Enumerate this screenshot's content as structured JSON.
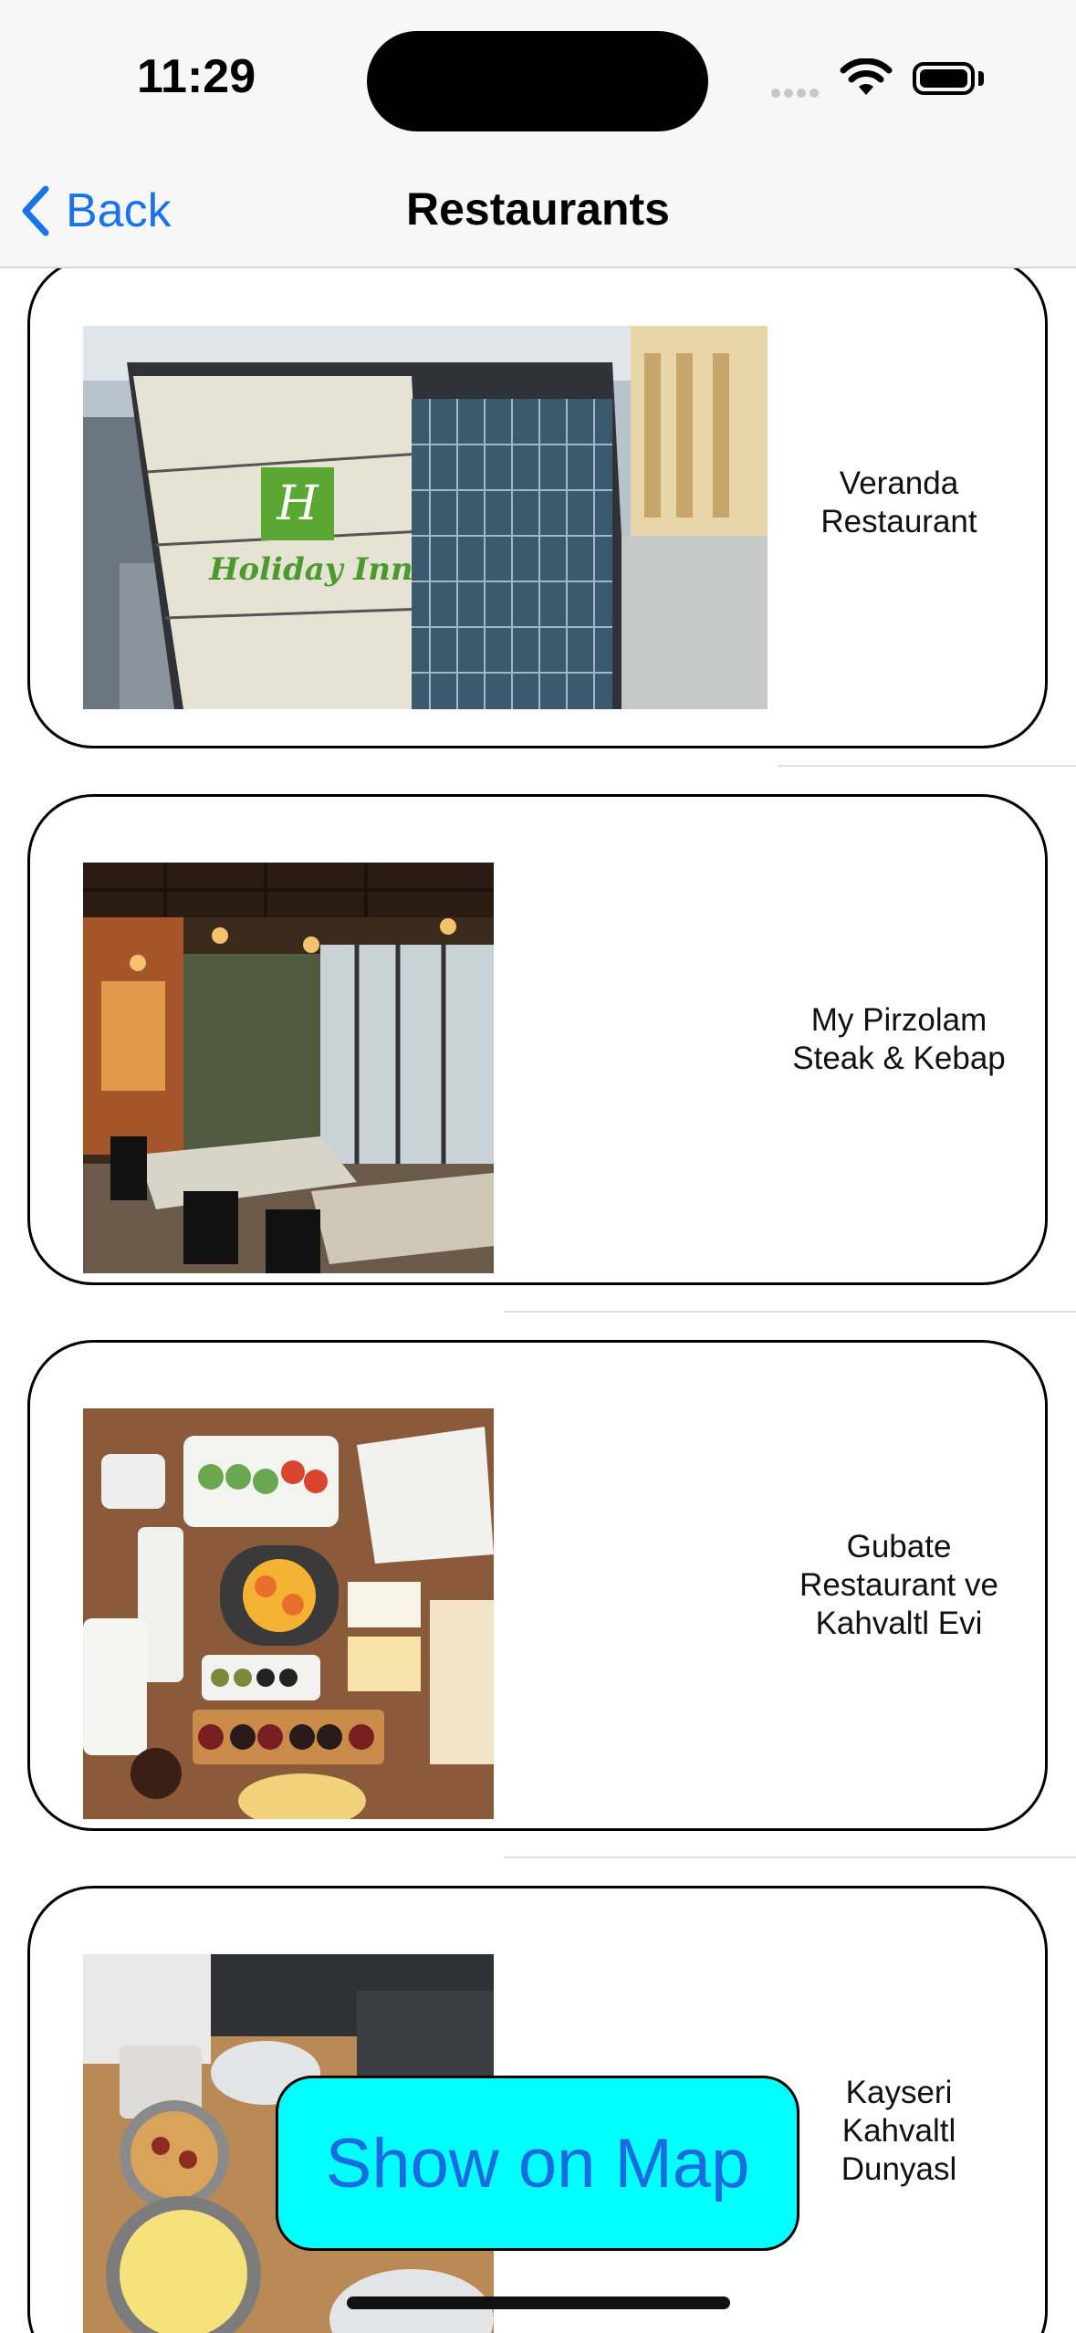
{
  "status_bar": {
    "time": "11:29"
  },
  "nav": {
    "back_label": "Back",
    "title": "Restaurants"
  },
  "restaurants": [
    {
      "name": "Veranda\nRestaurant",
      "image": "hotel-building-photo"
    },
    {
      "name": "My Pirzolam\nSteak & Kebap",
      "image": "restaurant-interior-photo"
    },
    {
      "name": "Gubate\nRestaurant ve\nKahvaltl Evi",
      "image": "breakfast-spread-photo"
    },
    {
      "name": "Kayseri\nKahvaltl\nDunyasl",
      "image": "breakfast-table-photo"
    }
  ],
  "actions": {
    "show_on_map": "Show on Map"
  },
  "colors": {
    "accent": "#1a73e8",
    "map_button_bg": "#00ffff"
  }
}
